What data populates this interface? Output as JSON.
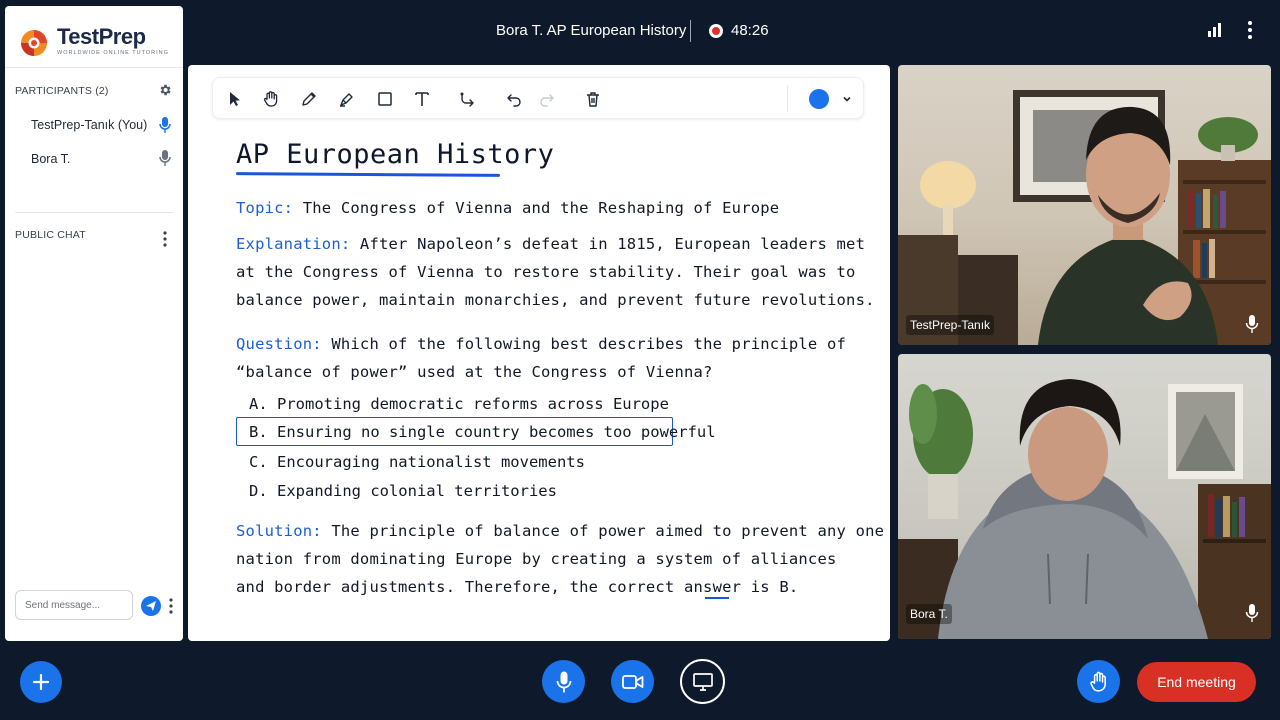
{
  "header": {
    "meeting_title": "Bora T. AP European History",
    "timer": "48:26",
    "signal_icon": "signal-bars-icon",
    "more_icon": "more-vertical-icon"
  },
  "brand": {
    "name_part1": "Test",
    "name_part2": "Prep",
    "tagline": "WORLDWIDE ONLINE TUTORING"
  },
  "sidebar": {
    "participants_title": "PARTICIPANTS (2)",
    "participants": [
      {
        "name": "TestPrep-Tanık (You)",
        "mic": "active"
      },
      {
        "name": "Bora T.",
        "mic": "muted-style"
      }
    ],
    "chat_title": "PUBLIC CHAT",
    "chat_placeholder": "Send message..."
  },
  "whiteboard": {
    "tools": [
      "select-icon",
      "hand-icon",
      "pencil-icon",
      "highlighter-icon",
      "rectangle-icon",
      "text-icon",
      "connector-icon",
      "undo-icon",
      "redo-icon",
      "trash-icon"
    ],
    "pen_color": "#1a73e8",
    "title": "AP European History",
    "topic_label": "Topic:",
    "topic": " The Congress of Vienna and the Reshaping of Europe",
    "explanation_label": "Explanation:",
    "explanation_lines": [
      " After Napoleon’s defeat in 1815, European leaders met",
      "at the Congress of Vienna to restore stability. Their goal was to",
      "balance power, maintain monarchies, and prevent future revolutions."
    ],
    "question_label": "Question:",
    "question_lines": [
      " Which of the following best describes the principle of",
      "“balance of power” used at the Congress of Vienna?"
    ],
    "options": [
      "A.  Promoting democratic reforms across Europe",
      "B.  Ensuring no single country becomes too powerful",
      "C.  Encouraging nationalist movements",
      "D.  Expanding colonial territories"
    ],
    "selected_option": "B",
    "solution_label": "Solution:",
    "solution_lines": [
      " The principle of balance of power aimed to prevent any one",
      "nation from dominating Europe by creating a system of alliances",
      "and border adjustments. Therefore, the correct answer is "
    ],
    "answer": "B."
  },
  "videos": [
    {
      "name": "TestPrep-Tanık"
    },
    {
      "name": "Bora T."
    }
  ],
  "controls": {
    "end_label": "End meeting",
    "end_color": "#d93025",
    "accent": "#1a73e8"
  }
}
